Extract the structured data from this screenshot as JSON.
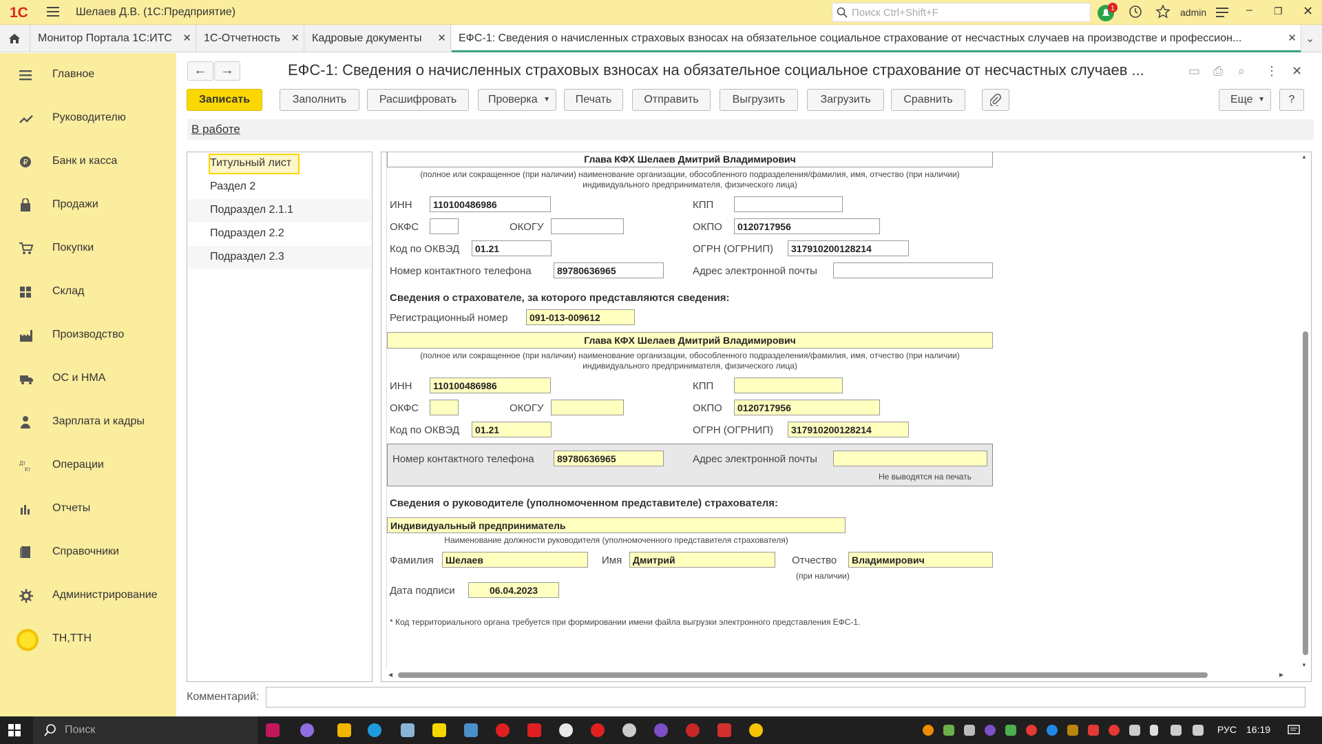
{
  "app": {
    "logo": "1С",
    "title": "Шелаев Д.В.  (1С:Предприятие)",
    "search_placeholder": "Поиск Ctrl+Shift+F",
    "notif_count": "1",
    "user": "admin"
  },
  "tabs": [
    {
      "label": "Монитор Портала 1С:ИТС"
    },
    {
      "label": "1С-Отчетность"
    },
    {
      "label": "Кадровые документы"
    },
    {
      "label": "ЕФС-1: Сведения о начисленных страховых взносах на обязательное социальное страхование от несчастных случаев на производстве и профессион..."
    }
  ],
  "sidebar": {
    "items": [
      {
        "label": "Главное",
        "icon": "menu-icon"
      },
      {
        "label": "Руководителю",
        "icon": "chart-trend-icon"
      },
      {
        "label": "Банк и касса",
        "icon": "ruble-icon"
      },
      {
        "label": "Продажи",
        "icon": "bag-icon"
      },
      {
        "label": "Покупки",
        "icon": "cart-icon"
      },
      {
        "label": "Склад",
        "icon": "warehouse-icon"
      },
      {
        "label": "Производство",
        "icon": "factory-icon"
      },
      {
        "label": "ОС и НМА",
        "icon": "truck-icon"
      },
      {
        "label": "Зарплата и кадры",
        "icon": "person-icon"
      },
      {
        "label": "Операции",
        "icon": "dt-kt-icon"
      },
      {
        "label": "Отчеты",
        "icon": "bar-chart-icon"
      },
      {
        "label": "Справочники",
        "icon": "book-icon"
      },
      {
        "label": "Администрирование",
        "icon": "gear-icon"
      },
      {
        "label": "ТН,ТТН",
        "icon": "circle-icon"
      }
    ]
  },
  "document": {
    "title": "ЕФС-1: Сведения о начисленных страховых взносах на обязательное социальное страхование от несчастных случаев ...",
    "status": "В работе"
  },
  "toolbar": {
    "save": "Записать",
    "fill": "Заполнить",
    "decode": "Расшифровать",
    "check": "Проверка",
    "print": "Печать",
    "send": "Отправить",
    "export": "Выгрузить",
    "import": "Загрузить",
    "compare": "Сравнить",
    "more": "Еще",
    "help": "?"
  },
  "sections": [
    {
      "label": "Титульный лист"
    },
    {
      "label": "Раздел 2"
    },
    {
      "label": "Подраздел 2.1.1"
    },
    {
      "label": "Подраздел 2.2"
    },
    {
      "label": "Подраздел 2.3"
    }
  ],
  "form": {
    "org_name_caption": "(полное или сокращенное (при наличии) наименование организации, обособленного подразделения/фамилия, имя, отчество (при наличии)",
    "org_name_caption2": "индивидуального предпринимателя, физического лица)",
    "labels": {
      "inn": "ИНН",
      "kpp": "КПП",
      "okfs": "ОКФС",
      "okogu": "ОКОГУ",
      "okpo": "ОКПО",
      "okved": "Код по ОКВЭД",
      "ogrn": "ОГРН (ОГРНИП)",
      "phone": "Номер контактного телефона",
      "email": "Адрес электронной почты",
      "reg_number": "Регистрационный номер",
      "not_printed": "Не выводятся на печать",
      "lastname": "Фамилия",
      "firstname": "Имя",
      "patronymic": "Отчество",
      "patronymic_note": "(при наличии)",
      "sign_date": "Дата подписи",
      "position_caption": "Наименование должности руководителя (уполномоченного представителя страхователя)"
    },
    "top_block": {
      "name": "Глава КФХ Шелаев Дмитрий Владимирович",
      "inn": "110100486986",
      "kpp": "",
      "okfs": "",
      "okogu": "",
      "okpo": "0120717956",
      "okved": "01.21",
      "ogrn": "317910200128214",
      "phone": "89780636965",
      "email": ""
    },
    "insurer_heading": "Сведения о страхователе, за которого представляются сведения:",
    "insurer": {
      "reg_number": "091-013-009612",
      "name": "Глава КФХ Шелаев Дмитрий Владимирович",
      "inn": "110100486986",
      "kpp": "",
      "okfs": "",
      "okogu": "",
      "okpo": "0120717956",
      "okved": "01.21",
      "ogrn": "317910200128214",
      "phone": "89780636965",
      "email": ""
    },
    "head_heading": "Сведения о руководителе (уполномоченном представителе) страхователя:",
    "head": {
      "position": "Индивидуальный предприниматель",
      "lastname": "Шелаев",
      "firstname": "Дмитрий",
      "patronymic": "Владимирович",
      "sign_date": "06.04.2023"
    },
    "footnote": "*  Код территориального органа требуется при формировании имени файла выгрузки электронного представления ЕФС-1."
  },
  "comment": {
    "label": "Комментарий:",
    "value": ""
  },
  "taskbar": {
    "search_placeholder": "Поиск",
    "lang": "РУС",
    "time": "16:19"
  },
  "colors": {
    "accent": "#fad700",
    "sidebar": "#fbed9e",
    "tab_active": "#3aa37b"
  }
}
